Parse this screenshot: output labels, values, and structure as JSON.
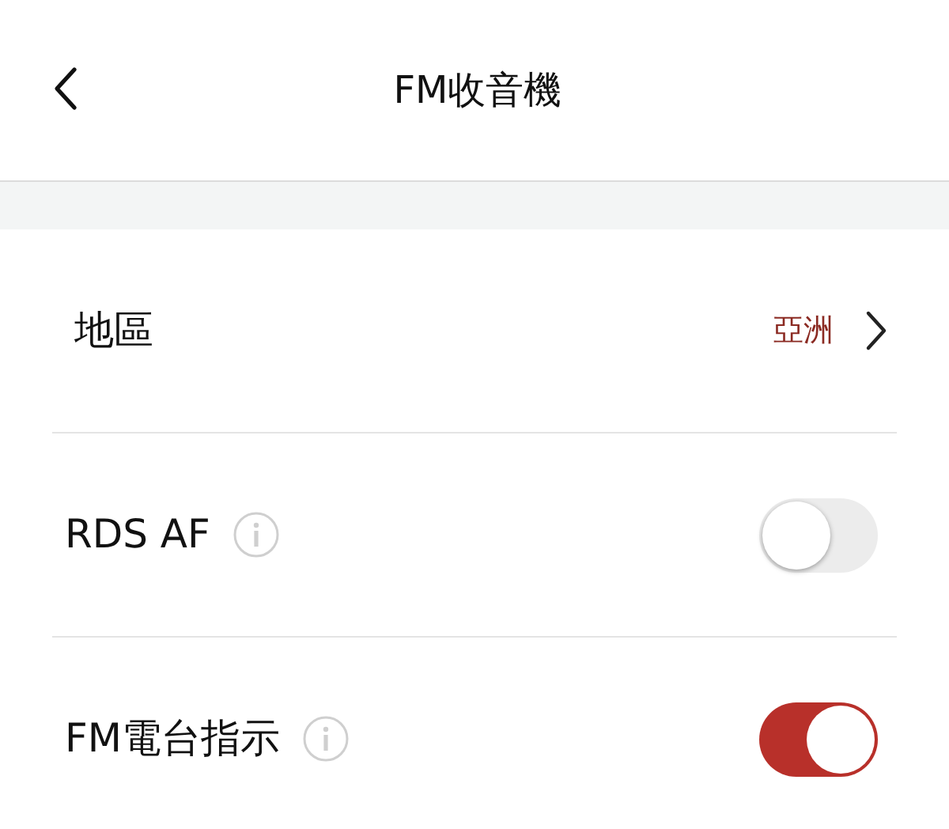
{
  "header": {
    "title": "FM收音機"
  },
  "settings": [
    {
      "kind": "link",
      "label": "地區",
      "value": "亞洲"
    },
    {
      "kind": "toggle",
      "label": "RDS AF",
      "on": false
    },
    {
      "kind": "toggle",
      "label": "FM電台指示",
      "on": true
    }
  ]
}
